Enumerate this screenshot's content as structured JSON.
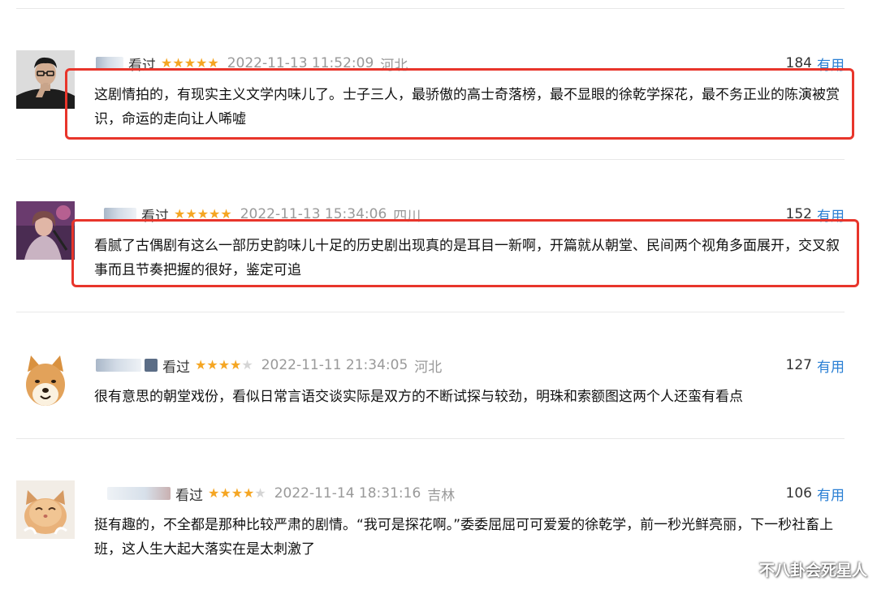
{
  "colors": {
    "star": "#f5a623",
    "link": "#2a7fd4",
    "highlight_box": "#e8352b",
    "muted": "#999999"
  },
  "reviews": [
    {
      "status": "看过",
      "rating": 5,
      "max_rating": 5,
      "timestamp": "2022-11-13 11:52:09",
      "location": "河北",
      "votes": "184",
      "helpful_label": "有用",
      "text": "这剧情拍的，有现实主义文学内味儿了。士子三人，最骄傲的高士奇落榜，最不显眼的徐乾学探花，最不务正业的陈演被赏识，命运的走向让人唏嘘",
      "avatar": "man-in-glasses-portrait",
      "highlighted": true
    },
    {
      "status": "看过",
      "rating": 5,
      "max_rating": 5,
      "timestamp": "2022-11-13 15:34:06",
      "location": "四川",
      "votes": "152",
      "helpful_label": "有用",
      "text": "看腻了古偶剧有这么一部历史韵味儿十足的历史剧出现真的是耳目一新啊，开篇就从朝堂、民间两个视角多面展开，交叉叙事而且节奏把握的很好，鉴定可追",
      "avatar": "performer-photo",
      "highlighted": true
    },
    {
      "status": "看过",
      "rating": 4,
      "max_rating": 5,
      "timestamp": "2022-11-11 21:34:05",
      "location": "河北",
      "votes": "127",
      "helpful_label": "有用",
      "text": "很有意思的朝堂戏份，看似日常言语交谈实际是双方的不断试探与较劲，明珠和索额图这两个人还蛮有看点",
      "avatar": "shiba-dog",
      "highlighted": false
    },
    {
      "status": "看过",
      "rating": 4,
      "max_rating": 5,
      "timestamp": "2022-11-14 18:31:16",
      "location": "吉林",
      "votes": "106",
      "helpful_label": "有用",
      "text": "挺有趣的，不全都是那种比较严肃的剧情。“我可是探花啊。”委委屈屈可可爱爱的徐乾学，前一秒光鲜亮丽，下一秒社畜上班，这人生大起大落实在是太刺激了",
      "avatar": "kitten",
      "highlighted": false
    }
  ],
  "watermark": "不八卦会死星人"
}
